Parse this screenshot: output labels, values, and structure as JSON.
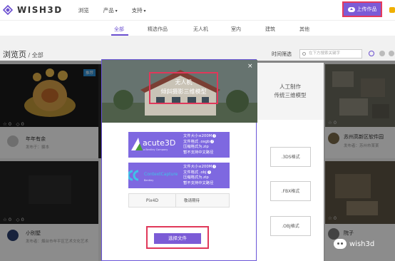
{
  "brand": {
    "name": "WISH3D",
    "accent": "#7b5bd6",
    "highlight": "#e0385a"
  },
  "nav": {
    "browse": "浏览",
    "products": "产品",
    "support": "支持"
  },
  "header": {
    "upload_label": "上传作品"
  },
  "categories": [
    "全部",
    "精选作品",
    "无人机",
    "室内",
    "建筑",
    "其他"
  ],
  "page": {
    "title": "浏览页",
    "subtitle": "全部",
    "filter_label": "时间筛选",
    "search_placeholder": "在下方搜索关键字"
  },
  "cards": [
    {
      "title": "年年有余",
      "author": "发布于：摄本",
      "badge": "推荐",
      "views": "0",
      "likes": "0"
    },
    {
      "title": "小别墅",
      "author": "发布者：烟台市牟平区艺术文化艺术",
      "views": "0",
      "likes": "0"
    },
    {
      "title": "苏州高新区软件园",
      "author": "发布者：苏州市某某",
      "views": "0",
      "likes": "0"
    },
    {
      "title": "院子",
      "author": "发布者：某某",
      "views": "0",
      "likes": "0"
    }
  ],
  "modal": {
    "hero_line1": "无人机",
    "hero_line2": "倾斜摄影三维模型",
    "close": "×",
    "formats": [
      {
        "logo": "acute3D",
        "logo_sub": "a Bentley Company",
        "lines": [
          "文件大小≤200M",
          "文件格式 .osgb",
          "压缩格式为.zip",
          "暂不支持中文路径"
        ]
      },
      {
        "logo": "ContextCapture",
        "logo_sub": "Bentley",
        "lines": [
          "文件大小≤200M",
          "文件格式 .obj",
          "压缩格式为.zip",
          "暂不支持中文路径"
        ]
      }
    ],
    "pix_logo": "Pix4D",
    "pix_text": "敬请期待",
    "choose_label": "选择文件"
  },
  "right_panel": {
    "line1": "人工制作",
    "line2": "传统三维模型",
    "formats": [
      ".3DS格式",
      ".FBX格式",
      ".OBJ格式"
    ]
  },
  "watermark": "wish3d"
}
